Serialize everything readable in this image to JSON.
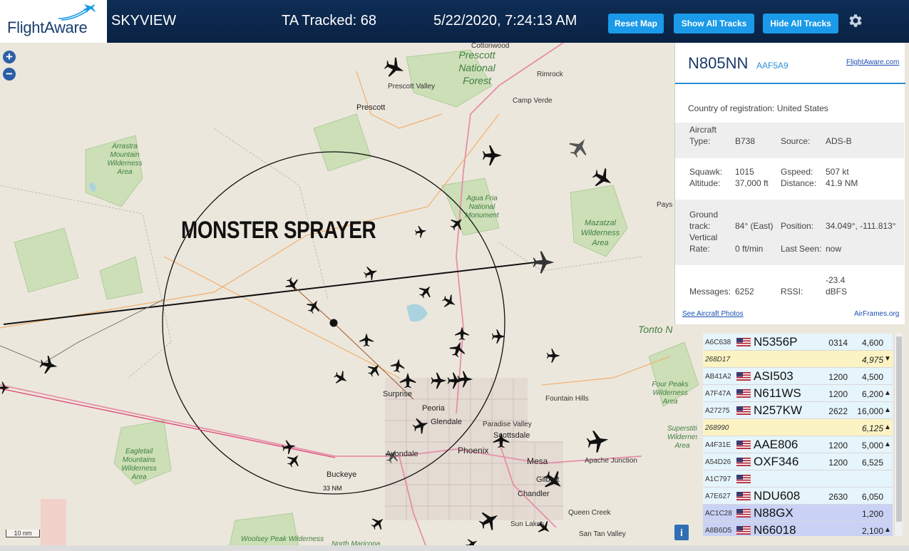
{
  "header": {
    "logo_text": "FlightAware",
    "app_title": "SKYVIEW",
    "tracked": "TA Tracked: 68",
    "datetime": "5/22/2020, 7:24:13 AM",
    "buttons": {
      "reset": "Reset Map",
      "show_all": "Show All Tracks",
      "hide_all": "Hide All Tracks"
    },
    "settings_icon": "gear-icon",
    "colors": {
      "bar": "#0e2d55",
      "button": "#1a9ae8",
      "logo": "#1b3e6f"
    }
  },
  "map": {
    "zoom_in": "+",
    "zoom_out": "−",
    "overlay_text": "MONSTER SPRAYER",
    "range_ring_label": "33 NM",
    "scale_label": "10 nm",
    "info_button": "i",
    "labels": {
      "cottonwood": "Cottonwood",
      "prescott_nf": "Prescott National Forest",
      "prescott_valley": "Prescott Valley",
      "rimrock": "Rimrock",
      "camp_verde": "Camp Verde",
      "prescott": "Prescott",
      "arrastra": "Arrastra Mountain Wilderness Area",
      "agua_fria": "Agua Fria National Monument",
      "mazatzal": "Mazatzal Wilderness Area",
      "pays": "Pays",
      "tonto": "Tonto National Forest",
      "fountain_hills": "Fountain Hills",
      "four_peaks": "Four Peaks Wilderness Area",
      "superstition": "Superstition Wilderness Area",
      "surprise": "Surprise",
      "peoria": "Peoria",
      "glendale": "Glendale",
      "paradise_valley": "Paradise Valley",
      "scottsdale": "Scottsdale",
      "phoenix": "Phoenix",
      "avondale": "Avondale",
      "mesa": "Mesa",
      "apache_junction": "Apache Junction",
      "gilbert": "Gilbert",
      "chandler": "Chandler",
      "queen_creek": "Queen Creek",
      "sun_lakes": "Sun Lakes",
      "san_tan_valley": "San Tan Valley",
      "eagletail": "Eagletail Mountains Wilderness Area",
      "buckeye": "Buckeye",
      "woolsey": "Woolsey Peak Wilderness",
      "north_maricopa": "North Maricopa"
    }
  },
  "panel": {
    "registration": "N805NN",
    "hex": "AAF5A9",
    "fa_link": "FlightAware.com",
    "country_label": "Country of registration:",
    "country": "United States",
    "aircraft_type_label": "Aircraft Type:",
    "aircraft_type": "B738",
    "source_label": "Source:",
    "source": "ADS-B",
    "squawk_label": "Squawk:",
    "squawk": "1015",
    "altitude_label": "Altitude:",
    "altitude": "37,000 ft",
    "gspeed_label": "Gspeed:",
    "gspeed": "507 kt",
    "distance_label": "Distance:",
    "distance": "41.9 NM",
    "ground_track_label": "Ground track:",
    "ground_track": "84° (East)",
    "position_label": "Position:",
    "position": "34.049°, -111.813°",
    "vertical_rate_label": "Vertical Rate:",
    "vertical_rate": "0 ft/min",
    "last_seen_label": "Last Seen:",
    "last_seen": "now",
    "messages_label": "Messages:",
    "messages": "6252",
    "rssi_label": "RSSI:",
    "rssi": "-23.4 dBFS",
    "photos_link": "See Aircraft Photos",
    "airframes_link": "AirFrames.org"
  },
  "aircraft_list": [
    {
      "hex": "A6C638",
      "flag": true,
      "callsign": "N5356P",
      "squawk": "0314",
      "altitude": "4,600",
      "trend": "",
      "style": "normal"
    },
    {
      "hex": "268D17",
      "flag": false,
      "callsign": "",
      "squawk": "",
      "altitude": "4,975",
      "trend": "▼",
      "style": "yellow"
    },
    {
      "hex": "AB41A2",
      "flag": true,
      "callsign": "ASI503",
      "squawk": "1200",
      "altitude": "4,500",
      "trend": "",
      "style": "normal"
    },
    {
      "hex": "A7F47A",
      "flag": true,
      "callsign": "N611WS",
      "squawk": "1200",
      "altitude": "6,200",
      "trend": "▲",
      "style": "normal"
    },
    {
      "hex": "A27275",
      "flag": true,
      "callsign": "N257KW",
      "squawk": "2622",
      "altitude": "16,000",
      "trend": "▲",
      "style": "normal"
    },
    {
      "hex": "268990",
      "flag": false,
      "callsign": "",
      "squawk": "",
      "altitude": "6,125",
      "trend": "▲",
      "style": "yellow"
    },
    {
      "hex": "A4F31E",
      "flag": true,
      "callsign": "AAE806",
      "squawk": "1200",
      "altitude": "5,000",
      "trend": "▲",
      "style": "normal"
    },
    {
      "hex": "A54D26",
      "flag": true,
      "callsign": "OXF346",
      "squawk": "1200",
      "altitude": "6,525",
      "trend": "",
      "style": "normal"
    },
    {
      "hex": "A1C797",
      "flag": true,
      "callsign": "",
      "squawk": "",
      "altitude": "",
      "trend": "",
      "style": "normal"
    },
    {
      "hex": "A7E627",
      "flag": true,
      "callsign": "NDU608",
      "squawk": "2630",
      "altitude": "6,050",
      "trend": "",
      "style": "normal"
    },
    {
      "hex": "AC1C28",
      "flag": true,
      "callsign": "N88GX",
      "squawk": "",
      "altitude": "1,200",
      "trend": "",
      "style": "blue"
    },
    {
      "hex": "A8B6D5",
      "flag": true,
      "callsign": "N66018",
      "squawk": "",
      "altitude": "2,100",
      "trend": "▲",
      "style": "blue"
    }
  ]
}
